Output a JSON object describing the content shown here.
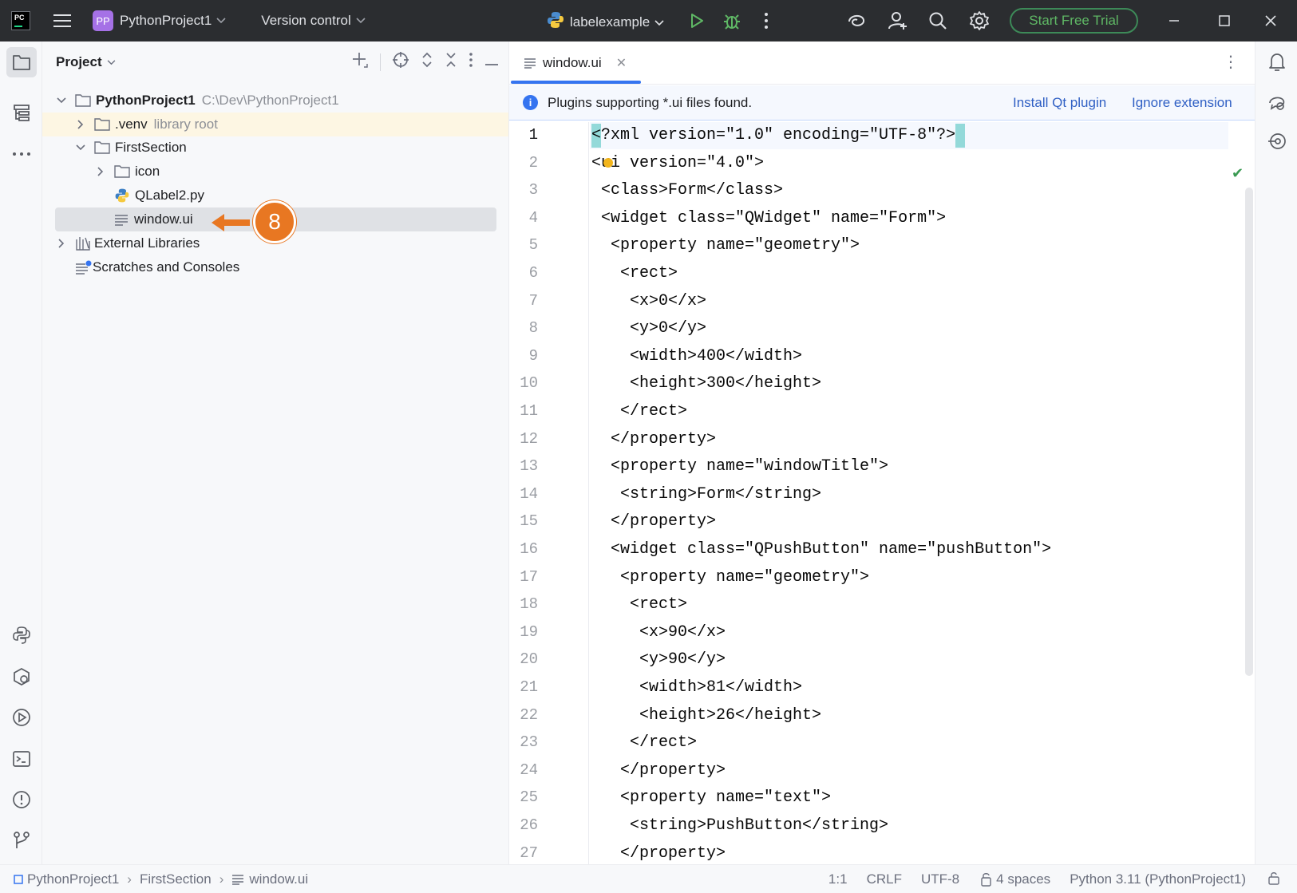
{
  "titlebar": {
    "logo_text": "PC",
    "project_badge": "PP",
    "project_name": "PythonProject1",
    "version_control": "Version control",
    "run_config": "labelexample",
    "trial_button": "Start Free Trial"
  },
  "project_panel": {
    "title": "Project",
    "tree": [
      {
        "label": "PythonProject1",
        "hint": "C:\\Dev\\PythonProject1"
      },
      {
        "label": ".venv",
        "hint": "library root"
      },
      {
        "label": "FirstSection"
      },
      {
        "label": "icon"
      },
      {
        "label": "QLabel2.py"
      },
      {
        "label": "window.ui"
      },
      {
        "label": "External Libraries"
      },
      {
        "label": "Scratches and Consoles"
      }
    ],
    "callout_number": "8"
  },
  "editor": {
    "tab_label": "window.ui",
    "banner": {
      "text": "Plugins supporting *.ui files found.",
      "install_link": "Install Qt plugin",
      "ignore_link": "Ignore extension"
    },
    "line_numbers": [
      "1",
      "2",
      "3",
      "4",
      "5",
      "6",
      "7",
      "8",
      "9",
      "10",
      "11",
      "12",
      "13",
      "14",
      "15",
      "16",
      "17",
      "18",
      "19",
      "20",
      "21",
      "22",
      "23",
      "24",
      "25",
      "26",
      "27"
    ],
    "code_lines": [
      "<?xml version=\"1.0\" encoding=\"UTF-8\"?>",
      "<ui version=\"4.0\">",
      " <class>Form</class>",
      " <widget class=\"QWidget\" name=\"Form\">",
      "  <property name=\"geometry\">",
      "   <rect>",
      "    <x>0</x>",
      "    <y>0</y>",
      "    <width>400</width>",
      "    <height>300</height>",
      "   </rect>",
      "  </property>",
      "  <property name=\"windowTitle\">",
      "   <string>Form</string>",
      "  </property>",
      "  <widget class=\"QPushButton\" name=\"pushButton\">",
      "   <property name=\"geometry\">",
      "    <rect>",
      "     <x>90</x>",
      "     <y>90</y>",
      "     <width>81</width>",
      "     <height>26</height>",
      "    </rect>",
      "   </property>",
      "   <property name=\"text\">",
      "    <string>PushButton</string>",
      "   </property>"
    ]
  },
  "statusbar": {
    "breadcrumb": [
      "PythonProject1",
      "FirstSection",
      "window.ui"
    ],
    "position": "1:1",
    "line_sep": "CRLF",
    "encoding": "UTF-8",
    "indent": "4 spaces",
    "interpreter": "Python 3.11 (PythonProject1)"
  },
  "colors": {
    "titlebar_bg": "#2b2d30",
    "accent_blue": "#3574f0",
    "callout_orange": "#e87722",
    "trial_green": "#5fb865"
  }
}
